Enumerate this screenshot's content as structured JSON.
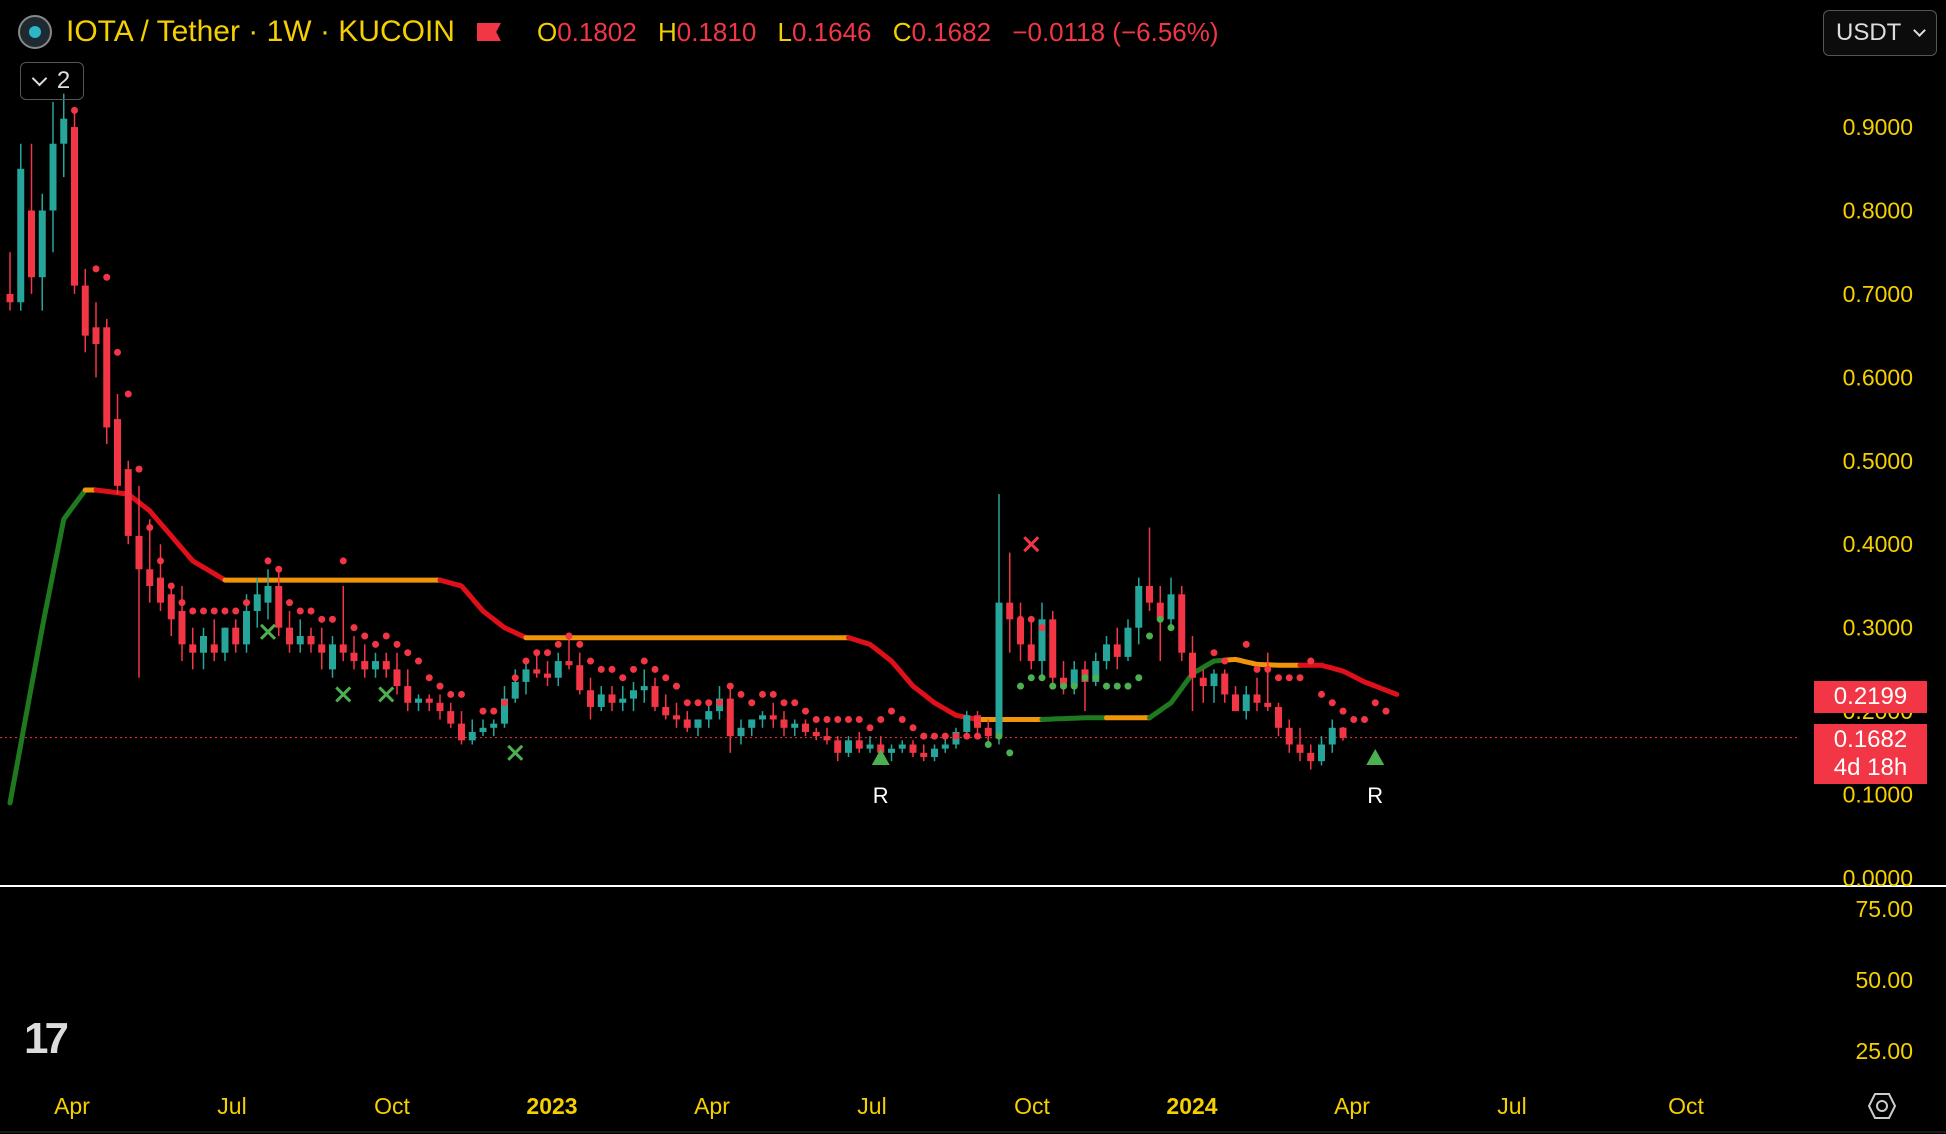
{
  "header": {
    "pair": "IOTA / Tether · 1W · KUCOIN",
    "ohlc": {
      "o_label": "O",
      "o": "0.1802",
      "h_label": "H",
      "h": "0.1810",
      "l_label": "L",
      "l": "0.1646",
      "c_label": "C",
      "c": "0.1682",
      "change": "−0.0118 (−6.56%)"
    },
    "indicator_count": "2",
    "currency": "USDT"
  },
  "price_tags": {
    "level": "0.2199",
    "last": "0.1682",
    "countdown": "4d 18h"
  },
  "icons": {
    "coin": "iota-coin-icon",
    "flag": "flag-icon",
    "chevron": "chevron-down-icon",
    "logo": "tradingview-logo-icon",
    "settings": "settings-icon"
  },
  "colors": {
    "up": "#26a69a",
    "down": "#f23645",
    "axis_text": "#f5d000",
    "line_green": "#1f7a1f",
    "line_red": "#e0101a",
    "line_orange": "#f0950a",
    "marker_green": "#4caf50",
    "marker_red": "#f23645"
  },
  "chart_data": {
    "type": "candlestick",
    "timeframe": "1W",
    "price_axis": {
      "ticks": [
        "0.9000",
        "0.8000",
        "0.7000",
        "0.6000",
        "0.5000",
        "0.4000",
        "0.3000",
        "0.2000",
        "0.1000",
        "0.0000"
      ],
      "ylim": [
        0,
        0.9
      ]
    },
    "sub_axis": {
      "ticks": [
        "75.00",
        "50.00",
        "25.00"
      ]
    },
    "time_axis": {
      "labels": [
        "Apr",
        "Jul",
        "Oct",
        "2023",
        "Apr",
        "Jul",
        "Oct",
        "2024",
        "Apr",
        "Jul",
        "Oct"
      ]
    },
    "last_price": 0.1682,
    "trailing_level": 0.2199,
    "candles": [
      [
        0.7,
        0.75,
        0.68,
        0.69
      ],
      [
        0.69,
        0.88,
        0.68,
        0.85
      ],
      [
        0.8,
        0.88,
        0.7,
        0.72
      ],
      [
        0.72,
        0.82,
        0.68,
        0.8
      ],
      [
        0.8,
        0.93,
        0.75,
        0.88
      ],
      [
        0.88,
        0.94,
        0.84,
        0.91
      ],
      [
        0.9,
        0.92,
        0.7,
        0.71
      ],
      [
        0.71,
        0.73,
        0.63,
        0.65
      ],
      [
        0.66,
        0.69,
        0.6,
        0.64
      ],
      [
        0.66,
        0.67,
        0.52,
        0.54
      ],
      [
        0.55,
        0.58,
        0.46,
        0.47
      ],
      [
        0.49,
        0.5,
        0.4,
        0.41
      ],
      [
        0.41,
        0.47,
        0.24,
        0.37
      ],
      [
        0.37,
        0.43,
        0.33,
        0.35
      ],
      [
        0.36,
        0.4,
        0.32,
        0.33
      ],
      [
        0.34,
        0.35,
        0.29,
        0.31
      ],
      [
        0.32,
        0.35,
        0.26,
        0.28
      ],
      [
        0.28,
        0.3,
        0.25,
        0.27
      ],
      [
        0.27,
        0.3,
        0.25,
        0.29
      ],
      [
        0.28,
        0.31,
        0.26,
        0.27
      ],
      [
        0.27,
        0.3,
        0.26,
        0.3
      ],
      [
        0.3,
        0.31,
        0.27,
        0.28
      ],
      [
        0.28,
        0.34,
        0.27,
        0.32
      ],
      [
        0.32,
        0.36,
        0.3,
        0.34
      ],
      [
        0.33,
        0.37,
        0.31,
        0.35
      ],
      [
        0.35,
        0.37,
        0.29,
        0.3
      ],
      [
        0.3,
        0.32,
        0.27,
        0.28
      ],
      [
        0.28,
        0.31,
        0.27,
        0.29
      ],
      [
        0.29,
        0.3,
        0.27,
        0.28
      ],
      [
        0.28,
        0.3,
        0.25,
        0.27
      ],
      [
        0.25,
        0.29,
        0.24,
        0.28
      ],
      [
        0.28,
        0.35,
        0.26,
        0.27
      ],
      [
        0.27,
        0.29,
        0.25,
        0.26
      ],
      [
        0.26,
        0.28,
        0.24,
        0.25
      ],
      [
        0.25,
        0.27,
        0.24,
        0.26
      ],
      [
        0.26,
        0.27,
        0.24,
        0.25
      ],
      [
        0.25,
        0.27,
        0.22,
        0.23
      ],
      [
        0.23,
        0.25,
        0.2,
        0.21
      ],
      [
        0.21,
        0.22,
        0.2,
        0.215
      ],
      [
        0.215,
        0.22,
        0.2,
        0.21
      ],
      [
        0.21,
        0.22,
        0.19,
        0.2
      ],
      [
        0.2,
        0.21,
        0.18,
        0.185
      ],
      [
        0.185,
        0.2,
        0.16,
        0.165
      ],
      [
        0.165,
        0.19,
        0.16,
        0.175
      ],
      [
        0.175,
        0.19,
        0.17,
        0.18
      ],
      [
        0.18,
        0.19,
        0.17,
        0.185
      ],
      [
        0.185,
        0.23,
        0.18,
        0.215
      ],
      [
        0.215,
        0.25,
        0.21,
        0.235
      ],
      [
        0.235,
        0.26,
        0.22,
        0.25
      ],
      [
        0.25,
        0.27,
        0.24,
        0.245
      ],
      [
        0.245,
        0.26,
        0.23,
        0.24
      ],
      [
        0.24,
        0.27,
        0.23,
        0.26
      ],
      [
        0.26,
        0.29,
        0.25,
        0.255
      ],
      [
        0.255,
        0.27,
        0.22,
        0.225
      ],
      [
        0.225,
        0.24,
        0.19,
        0.205
      ],
      [
        0.205,
        0.23,
        0.2,
        0.22
      ],
      [
        0.22,
        0.23,
        0.2,
        0.21
      ],
      [
        0.21,
        0.23,
        0.2,
        0.215
      ],
      [
        0.215,
        0.235,
        0.2,
        0.225
      ],
      [
        0.225,
        0.25,
        0.21,
        0.23
      ],
      [
        0.23,
        0.24,
        0.2,
        0.205
      ],
      [
        0.205,
        0.22,
        0.19,
        0.195
      ],
      [
        0.195,
        0.21,
        0.18,
        0.19
      ],
      [
        0.19,
        0.2,
        0.175,
        0.18
      ],
      [
        0.18,
        0.19,
        0.17,
        0.19
      ],
      [
        0.19,
        0.21,
        0.18,
        0.2
      ],
      [
        0.2,
        0.23,
        0.19,
        0.215
      ],
      [
        0.215,
        0.23,
        0.15,
        0.17
      ],
      [
        0.17,
        0.19,
        0.16,
        0.18
      ],
      [
        0.18,
        0.19,
        0.17,
        0.19
      ],
      [
        0.19,
        0.2,
        0.18,
        0.195
      ],
      [
        0.195,
        0.21,
        0.18,
        0.19
      ],
      [
        0.19,
        0.2,
        0.17,
        0.18
      ],
      [
        0.18,
        0.19,
        0.17,
        0.185
      ],
      [
        0.185,
        0.19,
        0.17,
        0.175
      ],
      [
        0.175,
        0.18,
        0.165,
        0.17
      ],
      [
        0.17,
        0.18,
        0.16,
        0.165
      ],
      [
        0.165,
        0.17,
        0.14,
        0.15
      ],
      [
        0.15,
        0.17,
        0.145,
        0.165
      ],
      [
        0.165,
        0.175,
        0.15,
        0.155
      ],
      [
        0.155,
        0.17,
        0.15,
        0.16
      ],
      [
        0.16,
        0.17,
        0.145,
        0.15
      ],
      [
        0.15,
        0.16,
        0.14,
        0.155
      ],
      [
        0.155,
        0.165,
        0.15,
        0.16
      ],
      [
        0.16,
        0.165,
        0.145,
        0.15
      ],
      [
        0.15,
        0.16,
        0.14,
        0.145
      ],
      [
        0.145,
        0.16,
        0.14,
        0.155
      ],
      [
        0.155,
        0.17,
        0.15,
        0.16
      ],
      [
        0.16,
        0.18,
        0.155,
        0.175
      ],
      [
        0.175,
        0.2,
        0.17,
        0.195
      ],
      [
        0.195,
        0.2,
        0.17,
        0.18
      ],
      [
        0.18,
        0.19,
        0.16,
        0.17
      ],
      [
        0.17,
        0.46,
        0.16,
        0.33
      ],
      [
        0.33,
        0.39,
        0.27,
        0.31
      ],
      [
        0.31,
        0.33,
        0.26,
        0.28
      ],
      [
        0.28,
        0.31,
        0.25,
        0.26
      ],
      [
        0.26,
        0.33,
        0.24,
        0.31
      ],
      [
        0.31,
        0.32,
        0.23,
        0.24
      ],
      [
        0.24,
        0.26,
        0.22,
        0.23
      ],
      [
        0.23,
        0.26,
        0.22,
        0.25
      ],
      [
        0.25,
        0.26,
        0.2,
        0.235
      ],
      [
        0.235,
        0.27,
        0.23,
        0.26
      ],
      [
        0.26,
        0.29,
        0.25,
        0.28
      ],
      [
        0.28,
        0.3,
        0.25,
        0.265
      ],
      [
        0.265,
        0.31,
        0.26,
        0.3
      ],
      [
        0.3,
        0.36,
        0.28,
        0.35
      ],
      [
        0.35,
        0.42,
        0.32,
        0.33
      ],
      [
        0.33,
        0.35,
        0.26,
        0.31
      ],
      [
        0.31,
        0.36,
        0.3,
        0.34
      ],
      [
        0.34,
        0.35,
        0.26,
        0.27
      ],
      [
        0.27,
        0.29,
        0.2,
        0.24
      ],
      [
        0.24,
        0.25,
        0.21,
        0.23
      ],
      [
        0.23,
        0.25,
        0.21,
        0.245
      ],
      [
        0.245,
        0.25,
        0.21,
        0.22
      ],
      [
        0.22,
        0.23,
        0.2,
        0.2
      ],
      [
        0.2,
        0.23,
        0.19,
        0.22
      ],
      [
        0.22,
        0.24,
        0.2,
        0.21
      ],
      [
        0.21,
        0.27,
        0.2,
        0.205
      ],
      [
        0.205,
        0.21,
        0.17,
        0.18
      ],
      [
        0.18,
        0.19,
        0.15,
        0.16
      ],
      [
        0.16,
        0.18,
        0.14,
        0.15
      ],
      [
        0.15,
        0.16,
        0.13,
        0.14
      ],
      [
        0.14,
        0.17,
        0.135,
        0.16
      ],
      [
        0.16,
        0.19,
        0.15,
        0.18
      ],
      [
        0.1802,
        0.181,
        0.1646,
        0.1682
      ]
    ],
    "dots_red": [
      [
        6,
        0.92
      ],
      [
        8,
        0.73
      ],
      [
        9,
        0.72
      ],
      [
        10,
        0.63
      ],
      [
        11,
        0.58
      ],
      [
        12,
        0.49
      ],
      [
        13,
        0.42
      ],
      [
        14,
        0.38
      ],
      [
        15,
        0.35
      ],
      [
        16,
        0.33
      ],
      [
        17,
        0.32
      ],
      [
        18,
        0.32
      ],
      [
        19,
        0.32
      ],
      [
        20,
        0.32
      ],
      [
        21,
        0.32
      ],
      [
        22,
        0.33
      ],
      [
        24,
        0.38
      ],
      [
        25,
        0.37
      ],
      [
        26,
        0.33
      ],
      [
        27,
        0.32
      ],
      [
        28,
        0.32
      ],
      [
        29,
        0.31
      ],
      [
        30,
        0.31
      ],
      [
        31,
        0.38
      ],
      [
        32,
        0.3
      ],
      [
        33,
        0.29
      ],
      [
        34,
        0.28
      ],
      [
        35,
        0.29
      ],
      [
        36,
        0.28
      ],
      [
        37,
        0.27
      ],
      [
        38,
        0.26
      ],
      [
        39,
        0.24
      ],
      [
        40,
        0.23
      ],
      [
        41,
        0.22
      ],
      [
        42,
        0.22
      ],
      [
        44,
        0.2
      ],
      [
        45,
        0.2
      ],
      [
        46,
        0.21
      ],
      [
        47,
        0.24
      ],
      [
        48,
        0.26
      ],
      [
        49,
        0.27
      ],
      [
        50,
        0.27
      ],
      [
        51,
        0.28
      ],
      [
        52,
        0.29
      ],
      [
        53,
        0.28
      ],
      [
        54,
        0.26
      ],
      [
        55,
        0.25
      ],
      [
        56,
        0.25
      ],
      [
        57,
        0.24
      ],
      [
        58,
        0.25
      ],
      [
        59,
        0.26
      ],
      [
        60,
        0.25
      ],
      [
        61,
        0.24
      ],
      [
        62,
        0.23
      ],
      [
        63,
        0.21
      ],
      [
        64,
        0.21
      ],
      [
        65,
        0.21
      ],
      [
        66,
        0.21
      ],
      [
        67,
        0.23
      ],
      [
        68,
        0.22
      ],
      [
        69,
        0.21
      ],
      [
        70,
        0.22
      ],
      [
        71,
        0.22
      ],
      [
        72,
        0.21
      ],
      [
        73,
        0.21
      ],
      [
        74,
        0.2
      ],
      [
        75,
        0.19
      ],
      [
        76,
        0.19
      ],
      [
        77,
        0.19
      ],
      [
        78,
        0.19
      ],
      [
        79,
        0.19
      ],
      [
        80,
        0.18
      ],
      [
        81,
        0.19
      ],
      [
        82,
        0.2
      ],
      [
        83,
        0.19
      ],
      [
        84,
        0.18
      ],
      [
        85,
        0.17
      ],
      [
        86,
        0.17
      ],
      [
        87,
        0.17
      ],
      [
        88,
        0.17
      ],
      [
        89,
        0.17
      ],
      [
        90,
        0.17
      ],
      [
        94,
        0.31
      ],
      [
        95,
        0.31
      ],
      [
        96,
        0.3
      ],
      [
        112,
        0.27
      ],
      [
        113,
        0.26
      ],
      [
        115,
        0.28
      ],
      [
        116,
        0.25
      ],
      [
        117,
        0.25
      ],
      [
        118,
        0.24
      ],
      [
        119,
        0.24
      ],
      [
        120,
        0.24
      ],
      [
        121,
        0.26
      ],
      [
        122,
        0.22
      ],
      [
        123,
        0.21
      ],
      [
        124,
        0.2
      ],
      [
        125,
        0.19
      ],
      [
        126,
        0.19
      ],
      [
        127,
        0.21
      ],
      [
        128,
        0.2
      ]
    ],
    "dots_green": [
      [
        91,
        0.16
      ],
      [
        92,
        0.17
      ],
      [
        93,
        0.15
      ],
      [
        94,
        0.23
      ],
      [
        95,
        0.24
      ],
      [
        96,
        0.24
      ],
      [
        97,
        0.23
      ],
      [
        98,
        0.23
      ],
      [
        99,
        0.23
      ],
      [
        100,
        0.24
      ],
      [
        101,
        0.24
      ],
      [
        102,
        0.23
      ],
      [
        103,
        0.23
      ],
      [
        104,
        0.23
      ],
      [
        105,
        0.24
      ],
      [
        106,
        0.29
      ],
      [
        107,
        0.31
      ],
      [
        108,
        0.3
      ]
    ],
    "x_markers_green": [
      [
        24,
        0.295
      ],
      [
        31,
        0.22
      ],
      [
        35,
        0.22
      ],
      [
        47,
        0.15
      ]
    ],
    "x_markers_red": [
      [
        95,
        0.4
      ]
    ],
    "r_signals": [
      {
        "i": 81,
        "label": "R"
      },
      {
        "i": 127,
        "label": "R"
      }
    ],
    "trail_line": [
      [
        0,
        0.09
      ],
      [
        3,
        0.3
      ],
      [
        5,
        0.43
      ],
      [
        7,
        0.465
      ],
      [
        8,
        0.465
      ],
      [
        11,
        0.46
      ],
      [
        13,
        0.44
      ],
      [
        15,
        0.41
      ],
      [
        17,
        0.38
      ],
      [
        20,
        0.357
      ],
      [
        40,
        0.357
      ],
      [
        42,
        0.35
      ],
      [
        44,
        0.32
      ],
      [
        46,
        0.3
      ],
      [
        48,
        0.288
      ],
      [
        78,
        0.288
      ],
      [
        80,
        0.28
      ],
      [
        82,
        0.26
      ],
      [
        84,
        0.23
      ],
      [
        86,
        0.21
      ],
      [
        88,
        0.195
      ],
      [
        90,
        0.19
      ],
      [
        92,
        0.19
      ],
      [
        96,
        0.19
      ],
      [
        100,
        0.192
      ],
      [
        106,
        0.192
      ],
      [
        108,
        0.21
      ],
      [
        110,
        0.245
      ],
      [
        112,
        0.26
      ],
      [
        114,
        0.262
      ],
      [
        116,
        0.256
      ],
      [
        118,
        0.255
      ],
      [
        122,
        0.255
      ],
      [
        124,
        0.248
      ],
      [
        126,
        0.235
      ],
      [
        129,
        0.22
      ]
    ],
    "trail_segments": [
      {
        "from": 0,
        "to": 7,
        "color": "green"
      },
      {
        "from": 7,
        "to": 8,
        "color": "orange"
      },
      {
        "from": 8,
        "to": 20,
        "color": "red"
      },
      {
        "from": 20,
        "to": 40,
        "color": "orange"
      },
      {
        "from": 40,
        "to": 48,
        "color": "red"
      },
      {
        "from": 48,
        "to": 78,
        "color": "orange"
      },
      {
        "from": 78,
        "to": 90,
        "color": "red"
      },
      {
        "from": 90,
        "to": 96,
        "color": "orange"
      },
      {
        "from": 96,
        "to": 102,
        "color": "green"
      },
      {
        "from": 102,
        "to": 106,
        "color": "orange"
      },
      {
        "from": 106,
        "to": 113,
        "color": "green"
      },
      {
        "from": 113,
        "to": 120,
        "color": "orange"
      },
      {
        "from": 120,
        "to": 129,
        "color": "red"
      }
    ]
  }
}
